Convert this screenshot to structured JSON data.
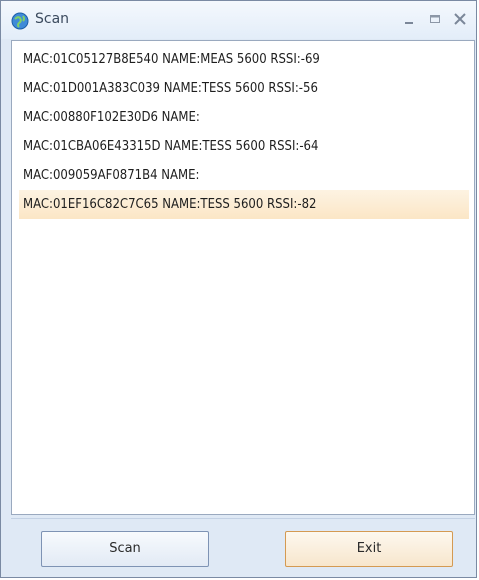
{
  "window": {
    "title": "Scan",
    "icon": "app-globe-icon",
    "controls": [
      "minimize-icon",
      "maximize-icon",
      "close-icon"
    ]
  },
  "devices": [
    {
      "label": "MAC:01C05127B8E540 NAME:MEAS 5600  RSSI:-69",
      "selected": false
    },
    {
      "label": "MAC:01D001A383C039 NAME:TESS 5600  RSSI:-56",
      "selected": false
    },
    {
      "label": "MAC:00880F102E30D6 NAME:",
      "selected": false
    },
    {
      "label": "MAC:01CBA06E43315D NAME:TESS 5600  RSSI:-64",
      "selected": false
    },
    {
      "label": "MAC:009059AF0871B4 NAME:",
      "selected": false
    },
    {
      "label": "MAC:01EF16C82C7C65 NAME:TESS 5600  RSSI:-82",
      "selected": true
    }
  ],
  "buttons": {
    "scan": "Scan",
    "exit": "Exit"
  },
  "colors": {
    "selected_row": "#fbe6c6",
    "window_bg": "#dfe9f5",
    "exit_border": "#d49a52"
  }
}
